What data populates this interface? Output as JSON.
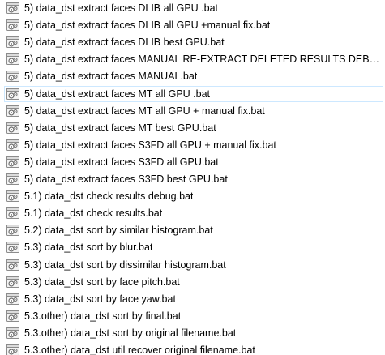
{
  "file_list": {
    "items": [
      {
        "name": "5) data_dst extract faces DLIB all GPU .bat",
        "icon": "batch-file-icon"
      },
      {
        "name": "5) data_dst extract faces DLIB all GPU +manual fix.bat",
        "icon": "batch-file-icon"
      },
      {
        "name": "5) data_dst extract faces DLIB best GPU.bat",
        "icon": "batch-file-icon"
      },
      {
        "name": "5) data_dst extract faces MANUAL RE-EXTRACT DELETED RESULTS DEBU...",
        "icon": "batch-file-icon"
      },
      {
        "name": "5) data_dst extract faces MANUAL.bat",
        "icon": "batch-file-icon"
      },
      {
        "name": "5) data_dst extract faces MT all GPU .bat",
        "icon": "batch-file-icon",
        "selected": true
      },
      {
        "name": "5) data_dst extract faces MT all GPU + manual fix.bat",
        "icon": "batch-file-icon"
      },
      {
        "name": "5) data_dst extract faces MT best GPU.bat",
        "icon": "batch-file-icon"
      },
      {
        "name": "5) data_dst extract faces S3FD all GPU + manual fix.bat",
        "icon": "batch-file-icon"
      },
      {
        "name": "5) data_dst extract faces S3FD all GPU.bat",
        "icon": "batch-file-icon"
      },
      {
        "name": "5) data_dst extract faces S3FD best GPU.bat",
        "icon": "batch-file-icon"
      },
      {
        "name": "5.1) data_dst check results debug.bat",
        "icon": "batch-file-icon"
      },
      {
        "name": "5.1) data_dst check results.bat",
        "icon": "batch-file-icon"
      },
      {
        "name": "5.2) data_dst sort by similar histogram.bat",
        "icon": "batch-file-icon"
      },
      {
        "name": "5.3) data_dst sort by blur.bat",
        "icon": "batch-file-icon"
      },
      {
        "name": "5.3) data_dst sort by dissimilar histogram.bat",
        "icon": "batch-file-icon"
      },
      {
        "name": "5.3) data_dst sort by face pitch.bat",
        "icon": "batch-file-icon"
      },
      {
        "name": "5.3) data_dst sort by face yaw.bat",
        "icon": "batch-file-icon"
      },
      {
        "name": "5.3.other) data_dst sort by final.bat",
        "icon": "batch-file-icon"
      },
      {
        "name": "5.3.other) data_dst sort by original filename.bat",
        "icon": "batch-file-icon"
      },
      {
        "name": "5.3.other) data_dst util recover original filename.bat",
        "icon": "batch-file-icon"
      }
    ]
  },
  "colors": {
    "selection_border": "#cde8ff",
    "icon_frame": "#9a9a9a",
    "icon_gear": "#7a7a7a",
    "text": "#000000"
  }
}
